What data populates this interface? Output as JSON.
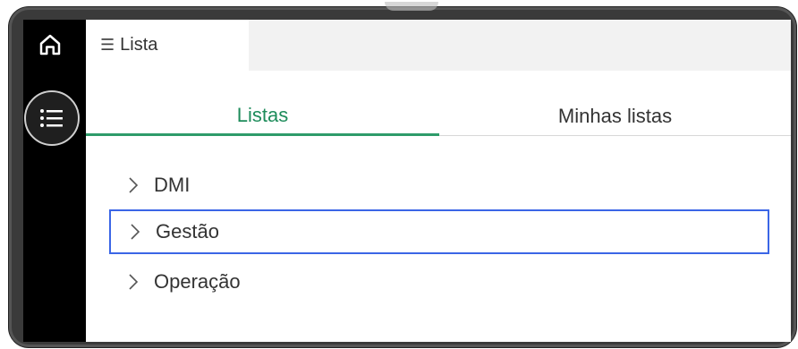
{
  "header": {
    "doc_tab_label": "Lista"
  },
  "tabs": [
    {
      "label": "Listas",
      "active": true
    },
    {
      "label": "Minhas listas",
      "active": false
    }
  ],
  "lists": [
    {
      "label": "DMI",
      "selected": false
    },
    {
      "label": "Gestão",
      "selected": true
    },
    {
      "label": "Operação",
      "selected": false
    }
  ],
  "icons": {
    "home": "home-icon",
    "list": "list-icon",
    "menu": "menu-icon",
    "chevron": "chevron-right-icon"
  },
  "colors": {
    "active_tab": "#1e8c5b",
    "active_underline": "#2e9b6a",
    "selection_outline": "#3b66e6",
    "rail": "#000000"
  }
}
